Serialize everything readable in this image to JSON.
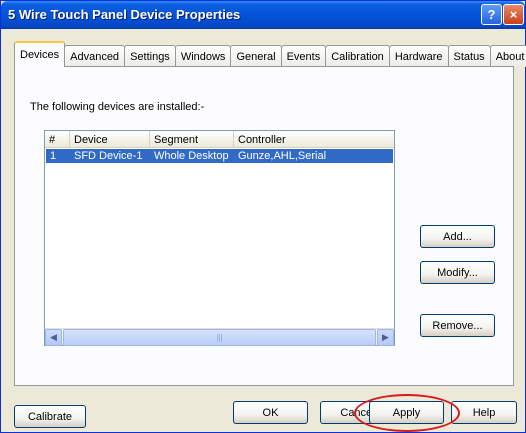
{
  "window": {
    "title": "5 Wire Touch Panel Device Properties",
    "help_glyph": "?",
    "close_glyph": "×"
  },
  "tabs": [
    {
      "label": "Devices",
      "active": true
    },
    {
      "label": "Advanced",
      "active": false
    },
    {
      "label": "Settings",
      "active": false
    },
    {
      "label": "Windows",
      "active": false
    },
    {
      "label": "General",
      "active": false
    },
    {
      "label": "Events",
      "active": false
    },
    {
      "label": "Calibration",
      "active": false
    },
    {
      "label": "Hardware",
      "active": false
    },
    {
      "label": "Status",
      "active": false
    },
    {
      "label": "About",
      "active": false
    }
  ],
  "devices_tab": {
    "installed_label": "The following devices are installed:-",
    "columns": [
      "#",
      "Device",
      "Segment",
      "Controller"
    ],
    "rows": [
      {
        "num": "1",
        "device": "SFD Device-1",
        "segment": "Whole Desktop",
        "controller": "Gunze,AHL,Serial"
      }
    ],
    "add_label": "Add...",
    "modify_label": "Modify...",
    "remove_label": "Remove..."
  },
  "footer": {
    "calibrate_label": "Calibrate",
    "ok_label": "OK",
    "cancel_label": "Cancel",
    "apply_label": "Apply",
    "help_label": "Help"
  },
  "colors": {
    "selection": "#316ac5",
    "highlight_oval": "#d91a1a",
    "titlebar": "#0553d8"
  }
}
